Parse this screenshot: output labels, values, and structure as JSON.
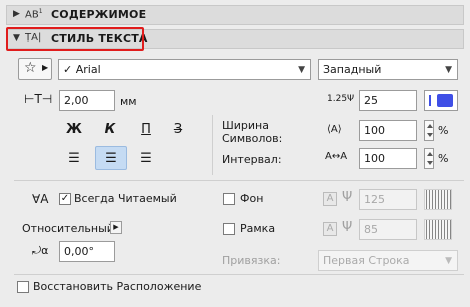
{
  "sections": {
    "contents": "СОДЕРЖИМОЕ",
    "text_style": "СТИЛЬ ТЕКСТА"
  },
  "font": {
    "name": "Arial",
    "checked": "✓",
    "script": "Западный"
  },
  "size": {
    "value": "2,00",
    "unit": "мм"
  },
  "pen": {
    "value": "25",
    "color": "#3f4fe6"
  },
  "labels": {
    "width_l1": "Ширина",
    "width_l2": "Символов:",
    "spacing": "Интервал:"
  },
  "width": {
    "value": "100",
    "unit": "%"
  },
  "spacing": {
    "value": "100",
    "unit": "%"
  },
  "format": {
    "bold": "Ж",
    "italic": "К",
    "underline": "П",
    "strike": "З"
  },
  "readable": {
    "label": "Всегда Читаемый",
    "checked": "✓"
  },
  "relative": {
    "label": "Относительный",
    "angle": "0,00°"
  },
  "background": {
    "label": "Фон",
    "pen": "125"
  },
  "frame": {
    "label": "Рамка",
    "pen": "85"
  },
  "anchor": {
    "label": "Привязка:",
    "value": "Первая Строка"
  },
  "restore": {
    "label": "Восстановить Расположение"
  }
}
